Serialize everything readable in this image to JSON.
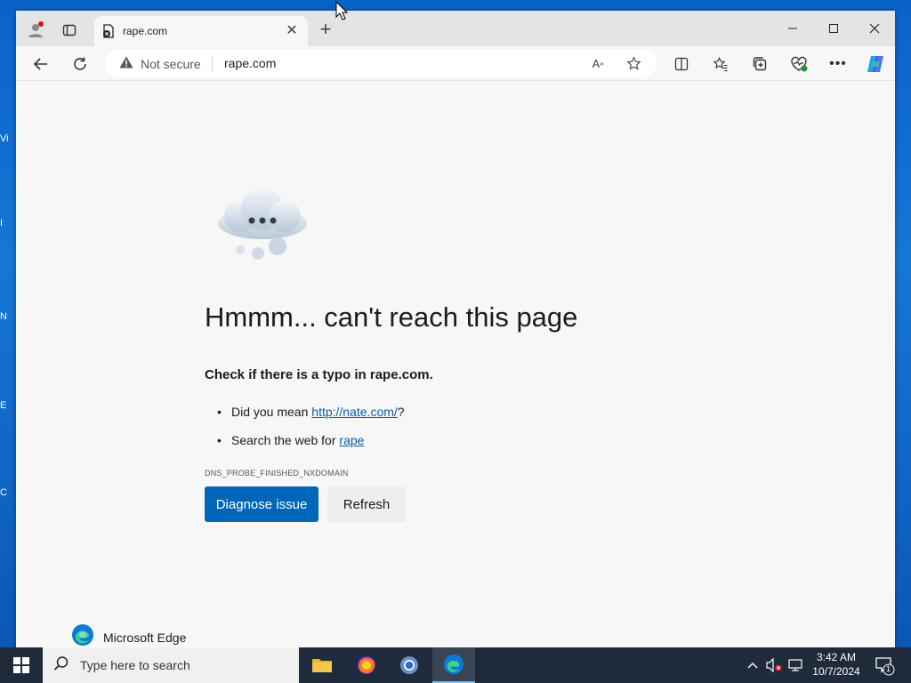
{
  "browser": {
    "tab": {
      "title": "rape.com"
    },
    "address": {
      "security_label": "Not secure",
      "url": "rape.com"
    }
  },
  "error_page": {
    "title": "Hmmm... can't reach this page",
    "subtitle": "Check if there is a typo in rape.com.",
    "suggestions": [
      {
        "prefix": "Did you mean ",
        "link": "http://nate.com/",
        "suffix": "?"
      },
      {
        "prefix": "Search the web for ",
        "link": "rape",
        "suffix": ""
      }
    ],
    "error_code": "DNS_PROBE_FINISHED_NXDOMAIN",
    "primary_button": "Diagnose issue",
    "secondary_button": "Refresh",
    "brand": "Microsoft Edge"
  },
  "taskbar": {
    "search_placeholder": "Type here to search",
    "time": "3:42 AM",
    "date": "10/7/2024",
    "notification_count": "1"
  },
  "desktop": {
    "icon_stubs": [
      "Vi",
      "I",
      "N",
      "E",
      "C"
    ]
  },
  "colors": {
    "accent": "#0067b8",
    "link": "#0b5cad",
    "taskbar": "#1f2a3a"
  }
}
